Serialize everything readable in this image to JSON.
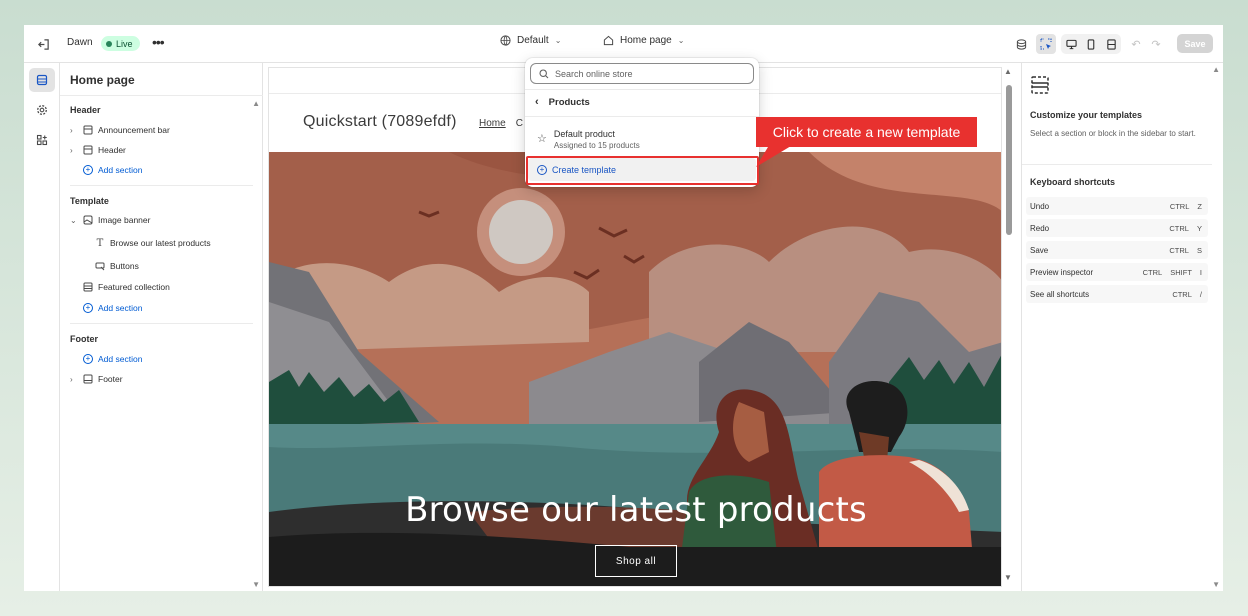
{
  "topbar": {
    "theme_name": "Dawn",
    "live_label": "Live",
    "more_label": "•••",
    "theme_selector": "Default",
    "page_selector": "Home page",
    "save_label": "Save"
  },
  "sidebar": {
    "title": "Home page",
    "header_section": "Header",
    "header_items": [
      "Announcement bar",
      "Header"
    ],
    "add_section": "Add section",
    "template_section": "Template",
    "template_items": {
      "image_banner": "Image banner",
      "browse_text": "Browse our latest products",
      "buttons": "Buttons",
      "featured": "Featured collection"
    },
    "footer_section": "Footer",
    "footer_item": "Footer"
  },
  "preview": {
    "store_title": "Quickstart (7089efdf)",
    "nav_home": "Home",
    "nav_partial": "C",
    "banner_heading": "Browse our latest products",
    "shop_button": "Shop all"
  },
  "dropdown": {
    "search_placeholder": "Search online store",
    "back_label": "Products",
    "default_title": "Default product",
    "default_subtitle": "Assigned to 15 products",
    "create_label": "Create template"
  },
  "callout": {
    "text": "Click to create a new template",
    "color": "#e8312f"
  },
  "right_panel": {
    "title": "Customize your templates",
    "description": "Select a section or block in the sidebar to start.",
    "shortcuts_title": "Keyboard shortcuts",
    "shortcuts": [
      {
        "label": "Undo",
        "keys": [
          "CTRL",
          "Z"
        ]
      },
      {
        "label": "Redo",
        "keys": [
          "CTRL",
          "Y"
        ]
      },
      {
        "label": "Save",
        "keys": [
          "CTRL",
          "S"
        ]
      },
      {
        "label": "Preview inspector",
        "keys": [
          "CTRL",
          "SHIFT",
          "I"
        ]
      },
      {
        "label": "See all shortcuts",
        "keys": [
          "CTRL",
          "/"
        ]
      }
    ]
  },
  "colors": {
    "accent": "#005bd3",
    "live_bg": "#cdfee1",
    "live_dot": "#29845a",
    "highlight": "#e8312f"
  }
}
